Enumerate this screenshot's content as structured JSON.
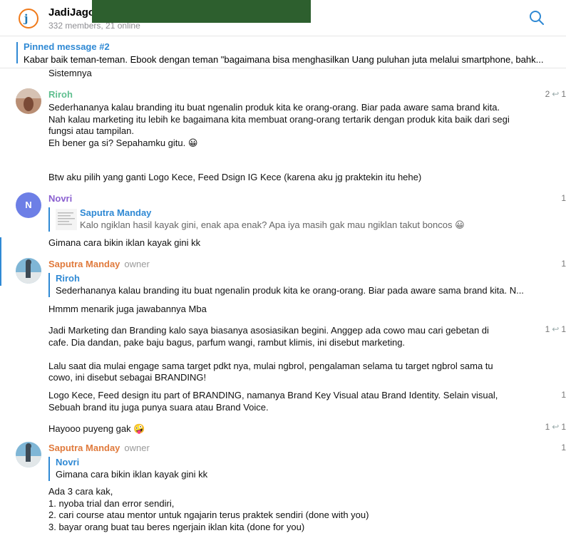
{
  "header": {
    "title": "JadiJago",
    "subtitle": "332 members, 21 online"
  },
  "pinned": {
    "title": "Pinned message #2",
    "text": "Kabar baik teman-teman. Ebook dengan teman \"bagaimana bisa menghasilkan Uang puluhan juta melalui smartphone, bahk..."
  },
  "messages": {
    "m0": {
      "text": "Sistemnya"
    },
    "m1": {
      "author": "Riroh",
      "author_color": "#5fbf8f",
      "count_reply": "2",
      "count_view": "1",
      "text1": "Sederhananya kalau branding itu buat ngenalin produk kita ke orang-orang. Biar pada aware sama brand kita.\nNah kalau marketing itu lebih ke bagaimana kita membuat orang-orang tertarik dengan produk kita baik dari segi\nfungsi atau tampilan.\nEh bener ga si? Sepahamku gitu. 😀",
      "text2": "Btw aku pilih yang ganti Logo Kece, Feed Dsign IG Kece (karena aku jg praktekin itu hehe)"
    },
    "m2": {
      "author": "Novri",
      "author_color": "#8a5fd0",
      "avatar_letter": "N",
      "count_view": "1",
      "quote_name": "Saputra Manday",
      "quote_text": "Kalo ngiklan hasil kayak gini, enak apa enak? Apa iya masih gak mau ngiklan takut boncos 😀",
      "text": "Gimana cara bikin iklan kayak gini kk"
    },
    "m3": {
      "author": "Saputra Manday",
      "author_color": "#e07a3c",
      "role": "owner",
      "count_view": "1",
      "quote_name": "Riroh",
      "quote_text": "Sederhananya kalau branding itu buat ngenalin produk kita ke orang-orang. Biar pada aware sama brand kita.  N...",
      "text": "Hmmm menarik juga jawabannya Mba"
    },
    "m4": {
      "count_reply": "1",
      "count_view": "1",
      "text": "Jadi Marketing dan Branding kalo saya biasanya asosiasikan begini. Anggep ada cowo mau cari gebetan di\ncafe. Dia dandan, pake baju bagus, parfum wangi, rambut klimis, ini disebut marketing.\n\nLalu saat dia mulai engage sama target pdkt nya, mulai ngbrol, pengalaman selama tu target ngbrol sama tu\ncowo, ini disebut sebagai BRANDING!"
    },
    "m5": {
      "count_view": "1",
      "text": "Logo Kece, Feed design itu part of BRANDING, namanya Brand Key Visual atau Brand Identity. Selain visual,\nSebuah brand itu juga punya suara atau Brand Voice."
    },
    "m6": {
      "count_reply": "1",
      "count_view": "1",
      "text": "Hayooo puyeng gak 🤪"
    },
    "m7": {
      "author": "Saputra Manday",
      "role": "owner",
      "count_view": "1",
      "quote_name": "Novri",
      "quote_text": "Gimana cara bikin iklan kayak gini kk",
      "text": "Ada 3 cara kak,\n1. nyoba trial dan error sendiri,\n2. cari course atau mentor untuk ngajarin terus praktek sendiri (done with you)\n3. bayar orang buat tau beres ngerjain iklan kita (done for you)"
    }
  },
  "icons": {
    "reply": "↩"
  }
}
